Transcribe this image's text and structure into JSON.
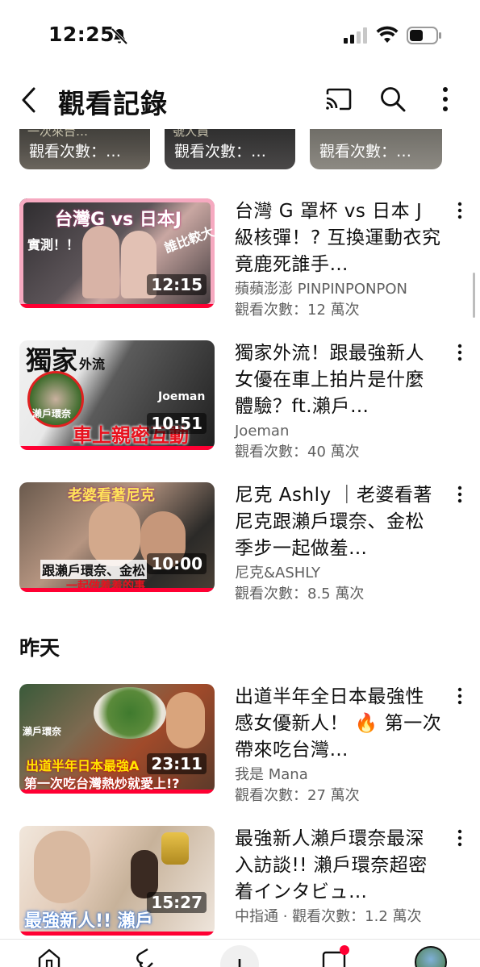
{
  "status_bar": {
    "time": "12:25"
  },
  "header": {
    "title": "觀看記錄"
  },
  "partial_row": [
    {
      "overlay": "一次來台…",
      "views": "觀看次數：…"
    },
    {
      "overlay": "號人員",
      "views": "觀看次數：…"
    },
    {
      "overlay": "",
      "views": "觀看次數：…"
    }
  ],
  "videos": [
    {
      "title": "台灣 G 罩杯 vs 日本 J 級核彈！? 互換運動衣究竟鹿死誰手…",
      "channel": "蘋蘋澎澎 PINPINPONPON",
      "views": "觀看次數：12 萬次",
      "duration": "12:15",
      "thumb_text": [
        "台灣G vs 日本J",
        "實測！！",
        "誰比較大"
      ]
    },
    {
      "title": "獨家外流！跟最強新人女優在車上拍片是什麼體驗？ft.瀨戶…",
      "channel": "Joeman",
      "views": "觀看次數：40 萬次",
      "duration": "10:51",
      "thumb_text": [
        "獨家",
        "外流",
        "Joeman",
        "瀨戶環奈",
        "車上親密互動"
      ]
    },
    {
      "title": "尼克 Ashly ｜老婆看著尼克跟瀨戶環奈、金松季步一起做羞…",
      "channel": "尼克&ASHLY",
      "views": "觀看次數：8.5 萬次",
      "duration": "10:00",
      "thumb_text": [
        "老婆看著尼克",
        "跟瀨戶環奈、金松",
        "一起做羞羞的事"
      ]
    }
  ],
  "section_yesterday": "昨天",
  "videos_yesterday": [
    {
      "title": "出道半年全日本最強性感女優新人！ 🔥 第一次帶來吃台灣…",
      "channel": "我是 Mana",
      "views": "觀看次數：27 萬次",
      "duration": "23:11",
      "thumb_text": [
        "瀨戶環奈",
        "出道半年日本最強A",
        "第一次吃台灣熱炒就愛上!?"
      ]
    },
    {
      "title": "最強新人瀨戶環奈最深入訪談!! 瀨戶環奈超密着インタビュ…",
      "meta_line": "中指通 · 觀看次數：1.2 萬次",
      "duration": "15:27",
      "thumb_text": [
        "最強新人!! 瀨戶"
      ]
    }
  ],
  "colors": {
    "accent": "#ff0033",
    "text": "#0f0f0f",
    "secondary": "#606060"
  }
}
